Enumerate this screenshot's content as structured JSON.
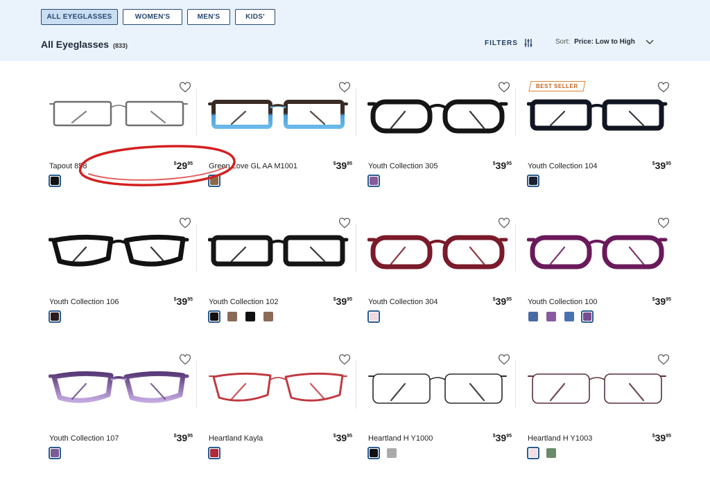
{
  "tabs": [
    {
      "label": "ALL EYEGLASSES",
      "active": true
    },
    {
      "label": "WOMEN'S",
      "active": false
    },
    {
      "label": "MEN'S",
      "active": false
    },
    {
      "label": "KIDS'",
      "active": false
    }
  ],
  "heading": {
    "title": "All Eyeglasses",
    "count": "(833)"
  },
  "filters": {
    "label": "FILTERS",
    "icon": "sliders-icon"
  },
  "sort": {
    "label": "Sort:",
    "value": "Price: Low to High",
    "icon": "chevron-down-icon"
  },
  "products": [
    {
      "name": "Tapout 858",
      "dollars": "29",
      "cents": "95",
      "badge": "",
      "frame": "#6f6f6f",
      "style": "metal-rect",
      "lens_tint": "#ffffff",
      "swatches": [
        {
          "color": "#111111",
          "selected": true
        }
      ]
    },
    {
      "name": "Green Love GL AA M1001",
      "dollars": "39",
      "cents": "95",
      "badge": "",
      "frame": "#3a2c25",
      "style": "two-tone-blue",
      "lens_tint": "#ffffff",
      "swatches": [
        {
          "color": "#8a6a4a",
          "selected": true
        }
      ]
    },
    {
      "name": "Youth Collection 305",
      "dollars": "39",
      "cents": "95",
      "badge": "",
      "frame": "#151515",
      "style": "round-thick",
      "lens_tint": "#ffffff",
      "swatches": [
        {
          "color": "#8a5a9a",
          "selected": true
        }
      ]
    },
    {
      "name": "Youth Collection 104",
      "dollars": "39",
      "cents": "95",
      "badge": "BEST SELLER",
      "frame": "#121622",
      "style": "rect-thick",
      "lens_tint": "#ffffff",
      "swatches": [
        {
          "color": "#1a2233",
          "selected": true
        }
      ]
    },
    {
      "name": "Youth Collection 106",
      "dollars": "39",
      "cents": "95",
      "badge": "",
      "frame": "#121212",
      "style": "cat-thick",
      "lens_tint": "#ffffff",
      "swatches": [
        {
          "color": "#2a1a1a",
          "selected": true
        }
      ]
    },
    {
      "name": "Youth Collection 102",
      "dollars": "39",
      "cents": "95",
      "badge": "",
      "frame": "#151515",
      "style": "rect-thick",
      "lens_tint": "#ffffff",
      "swatches": [
        {
          "color": "#111111",
          "selected": true
        },
        {
          "color": "#8a6a56",
          "selected": false
        },
        {
          "color": "#111111",
          "selected": false
        },
        {
          "color": "#8a6a56",
          "selected": false
        }
      ]
    },
    {
      "name": "Youth Collection 304",
      "dollars": "39",
      "cents": "95",
      "badge": "",
      "frame": "#7a1a2a",
      "style": "round-thick",
      "lens_tint": "#ffffff",
      "swatches": [
        {
          "color": "#f0d8e0",
          "selected": true
        }
      ]
    },
    {
      "name": "Youth Collection 100",
      "dollars": "39",
      "cents": "95",
      "badge": "",
      "frame": "#6a1a5a",
      "style": "round-thick",
      "lens_tint": "#ffffff",
      "swatches": [
        {
          "color": "#4a6aa6",
          "selected": false
        },
        {
          "color": "#8a5aa0",
          "selected": false
        },
        {
          "color": "#4a72b0",
          "selected": false
        },
        {
          "color": "#7a4a8e",
          "selected": true
        }
      ]
    },
    {
      "name": "Youth Collection 107",
      "dollars": "39",
      "cents": "95",
      "badge": "",
      "frame": "#6a4a88",
      "style": "cat-fade",
      "lens_tint": "#ffffff",
      "swatches": [
        {
          "color": "#7a5a96",
          "selected": true
        }
      ]
    },
    {
      "name": "Heartland Kayla",
      "dollars": "39",
      "cents": "95",
      "badge": "",
      "frame": "#c03a42",
      "style": "cat-metal",
      "lens_tint": "#ffffff",
      "swatches": [
        {
          "color": "#b02a3a",
          "selected": true
        }
      ]
    },
    {
      "name": "Heartland H Y1000",
      "dollars": "39",
      "cents": "95",
      "badge": "",
      "frame": "#2a2a2a",
      "style": "wire-rect",
      "lens_tint": "#ffffff",
      "swatches": [
        {
          "color": "#111111",
          "selected": true
        },
        {
          "color": "#aaaaaa",
          "selected": false
        }
      ]
    },
    {
      "name": "Heartland H Y1003",
      "dollars": "39",
      "cents": "95",
      "badge": "",
      "frame": "#5a3038",
      "style": "wire-rect",
      "lens_tint": "#ffffff",
      "swatches": [
        {
          "color": "#f2dde2",
          "selected": true
        },
        {
          "color": "#6a8a6a",
          "selected": false
        }
      ]
    }
  ],
  "annotation": {
    "color": "#d42020"
  }
}
